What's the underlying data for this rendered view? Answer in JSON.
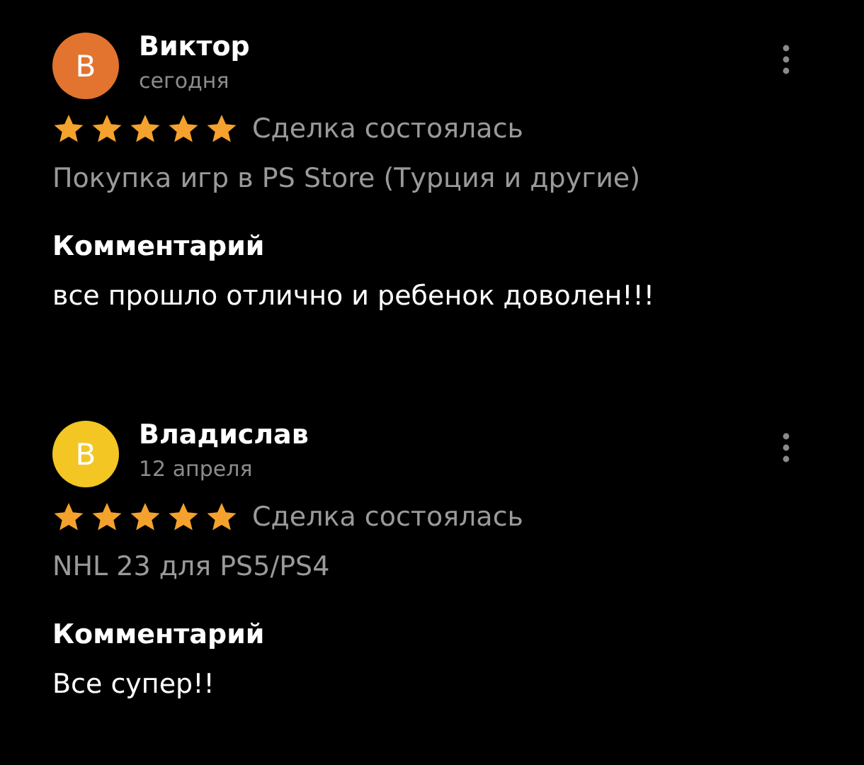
{
  "reviews": [
    {
      "avatar_letter": "В",
      "color": "#e2742f",
      "name": "Виктор",
      "date": "сегодня",
      "stars": 5,
      "status": "Сделка состоялась",
      "product": "Покупка игр в PS Store (Турция и другие)",
      "comment_label": "Комментарий",
      "comment": "все прошло отлично и ребенок доволен!!!"
    },
    {
      "avatar_letter": "В",
      "color": "#f3c623",
      "name": "Владислав",
      "date": "12 апреля",
      "stars": 5,
      "status": "Сделка состоялась",
      "product": "NHL 23 для PS5/PS4",
      "comment_label": "Комментарий",
      "comment": "Все супер!!"
    }
  ]
}
